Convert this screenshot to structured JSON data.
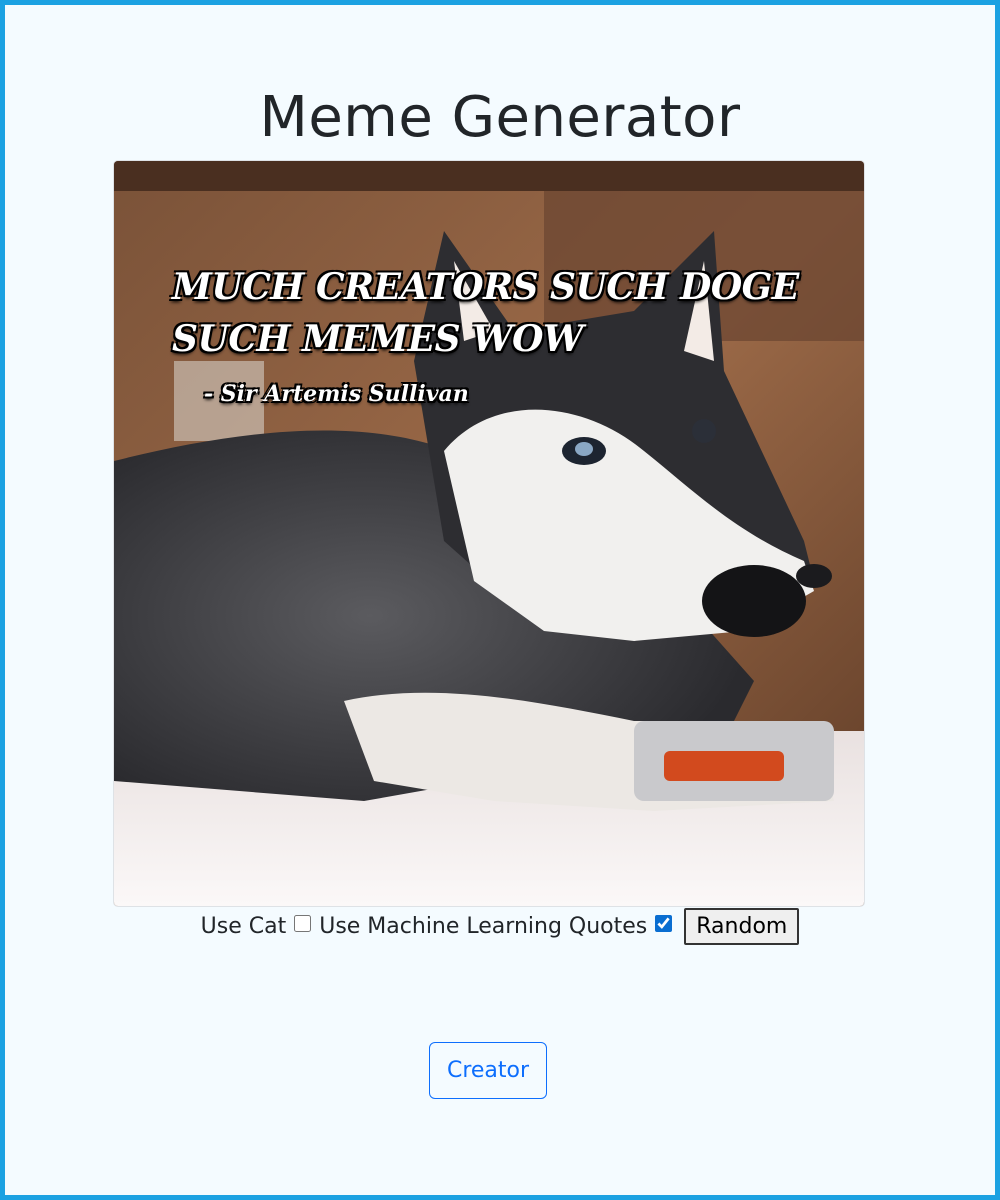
{
  "page": {
    "title": "Meme Generator"
  },
  "meme": {
    "line1": "MUCH CREATORS SUCH DOGE",
    "line2": "SUCH MEMES WOW",
    "attribution": "- Sir Artemis Sullivan"
  },
  "controls": {
    "use_cat_label": "Use Cat",
    "use_cat_checked": false,
    "use_ml_label": "Use Machine Learning Quotes",
    "use_ml_checked": true,
    "random_label": "Random"
  },
  "footer": {
    "creator_label": "Creator"
  },
  "colors": {
    "accent": "#0d6efd",
    "frame_border": "#1ba1e2",
    "background": "#f4fbff"
  }
}
